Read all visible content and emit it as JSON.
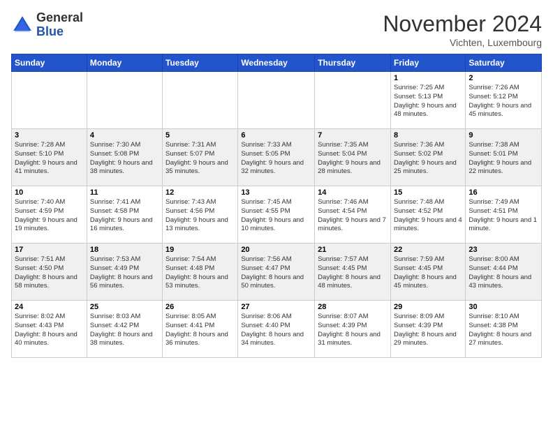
{
  "header": {
    "logo_general": "General",
    "logo_blue": "Blue",
    "title": "November 2024",
    "location": "Vichten, Luxembourg"
  },
  "weekdays": [
    "Sunday",
    "Monday",
    "Tuesday",
    "Wednesday",
    "Thursday",
    "Friday",
    "Saturday"
  ],
  "weeks": [
    [
      {
        "day": "",
        "info": ""
      },
      {
        "day": "",
        "info": ""
      },
      {
        "day": "",
        "info": ""
      },
      {
        "day": "",
        "info": ""
      },
      {
        "day": "",
        "info": ""
      },
      {
        "day": "1",
        "info": "Sunrise: 7:25 AM\nSunset: 5:13 PM\nDaylight: 9 hours\nand 48 minutes."
      },
      {
        "day": "2",
        "info": "Sunrise: 7:26 AM\nSunset: 5:12 PM\nDaylight: 9 hours\nand 45 minutes."
      }
    ],
    [
      {
        "day": "3",
        "info": "Sunrise: 7:28 AM\nSunset: 5:10 PM\nDaylight: 9 hours\nand 41 minutes."
      },
      {
        "day": "4",
        "info": "Sunrise: 7:30 AM\nSunset: 5:08 PM\nDaylight: 9 hours\nand 38 minutes."
      },
      {
        "day": "5",
        "info": "Sunrise: 7:31 AM\nSunset: 5:07 PM\nDaylight: 9 hours\nand 35 minutes."
      },
      {
        "day": "6",
        "info": "Sunrise: 7:33 AM\nSunset: 5:05 PM\nDaylight: 9 hours\nand 32 minutes."
      },
      {
        "day": "7",
        "info": "Sunrise: 7:35 AM\nSunset: 5:04 PM\nDaylight: 9 hours\nand 28 minutes."
      },
      {
        "day": "8",
        "info": "Sunrise: 7:36 AM\nSunset: 5:02 PM\nDaylight: 9 hours\nand 25 minutes."
      },
      {
        "day": "9",
        "info": "Sunrise: 7:38 AM\nSunset: 5:01 PM\nDaylight: 9 hours\nand 22 minutes."
      }
    ],
    [
      {
        "day": "10",
        "info": "Sunrise: 7:40 AM\nSunset: 4:59 PM\nDaylight: 9 hours\nand 19 minutes."
      },
      {
        "day": "11",
        "info": "Sunrise: 7:41 AM\nSunset: 4:58 PM\nDaylight: 9 hours\nand 16 minutes."
      },
      {
        "day": "12",
        "info": "Sunrise: 7:43 AM\nSunset: 4:56 PM\nDaylight: 9 hours\nand 13 minutes."
      },
      {
        "day": "13",
        "info": "Sunrise: 7:45 AM\nSunset: 4:55 PM\nDaylight: 9 hours\nand 10 minutes."
      },
      {
        "day": "14",
        "info": "Sunrise: 7:46 AM\nSunset: 4:54 PM\nDaylight: 9 hours\nand 7 minutes."
      },
      {
        "day": "15",
        "info": "Sunrise: 7:48 AM\nSunset: 4:52 PM\nDaylight: 9 hours\nand 4 minutes."
      },
      {
        "day": "16",
        "info": "Sunrise: 7:49 AM\nSunset: 4:51 PM\nDaylight: 9 hours\nand 1 minute."
      }
    ],
    [
      {
        "day": "17",
        "info": "Sunrise: 7:51 AM\nSunset: 4:50 PM\nDaylight: 8 hours\nand 58 minutes."
      },
      {
        "day": "18",
        "info": "Sunrise: 7:53 AM\nSunset: 4:49 PM\nDaylight: 8 hours\nand 56 minutes."
      },
      {
        "day": "19",
        "info": "Sunrise: 7:54 AM\nSunset: 4:48 PM\nDaylight: 8 hours\nand 53 minutes."
      },
      {
        "day": "20",
        "info": "Sunrise: 7:56 AM\nSunset: 4:47 PM\nDaylight: 8 hours\nand 50 minutes."
      },
      {
        "day": "21",
        "info": "Sunrise: 7:57 AM\nSunset: 4:45 PM\nDaylight: 8 hours\nand 48 minutes."
      },
      {
        "day": "22",
        "info": "Sunrise: 7:59 AM\nSunset: 4:45 PM\nDaylight: 8 hours\nand 45 minutes."
      },
      {
        "day": "23",
        "info": "Sunrise: 8:00 AM\nSunset: 4:44 PM\nDaylight: 8 hours\nand 43 minutes."
      }
    ],
    [
      {
        "day": "24",
        "info": "Sunrise: 8:02 AM\nSunset: 4:43 PM\nDaylight: 8 hours\nand 40 minutes."
      },
      {
        "day": "25",
        "info": "Sunrise: 8:03 AM\nSunset: 4:42 PM\nDaylight: 8 hours\nand 38 minutes."
      },
      {
        "day": "26",
        "info": "Sunrise: 8:05 AM\nSunset: 4:41 PM\nDaylight: 8 hours\nand 36 minutes."
      },
      {
        "day": "27",
        "info": "Sunrise: 8:06 AM\nSunset: 4:40 PM\nDaylight: 8 hours\nand 34 minutes."
      },
      {
        "day": "28",
        "info": "Sunrise: 8:07 AM\nSunset: 4:39 PM\nDaylight: 8 hours\nand 31 minutes."
      },
      {
        "day": "29",
        "info": "Sunrise: 8:09 AM\nSunset: 4:39 PM\nDaylight: 8 hours\nand 29 minutes."
      },
      {
        "day": "30",
        "info": "Sunrise: 8:10 AM\nSunset: 4:38 PM\nDaylight: 8 hours\nand 27 minutes."
      }
    ]
  ]
}
